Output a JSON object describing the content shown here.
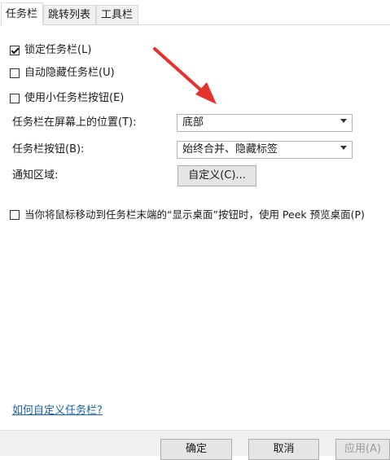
{
  "tabs": [
    {
      "label": "任务栏",
      "active": true
    },
    {
      "label": "跳转列表",
      "active": false
    },
    {
      "label": "工具栏",
      "active": false
    }
  ],
  "options": {
    "lock_taskbar": {
      "label": "锁定任务栏(L)",
      "checked": true
    },
    "auto_hide": {
      "label": "自动隐藏任务栏(U)",
      "checked": false
    },
    "small_buttons": {
      "label": "使用小任务栏按钮(E)",
      "checked": false
    },
    "peek": {
      "label": "当你将鼠标移动到任务栏末端的“显示桌面”按钮时，使用 Peek 预览桌面(P)",
      "checked": false
    }
  },
  "position": {
    "label": "任务栏在屏幕上的位置(T):",
    "value": "底部"
  },
  "buttons_setting": {
    "label": "任务栏按钮(B):",
    "value": "始终合并、隐藏标签"
  },
  "notification": {
    "label": "通知区域:",
    "button": "自定义(C)..."
  },
  "help_link": "如何自定义任务栏?",
  "footer": {
    "ok": "确定",
    "cancel": "取消",
    "apply": "应用(A)"
  },
  "colors": {
    "arrow": "#e5322d",
    "link": "#1d5fa6"
  }
}
